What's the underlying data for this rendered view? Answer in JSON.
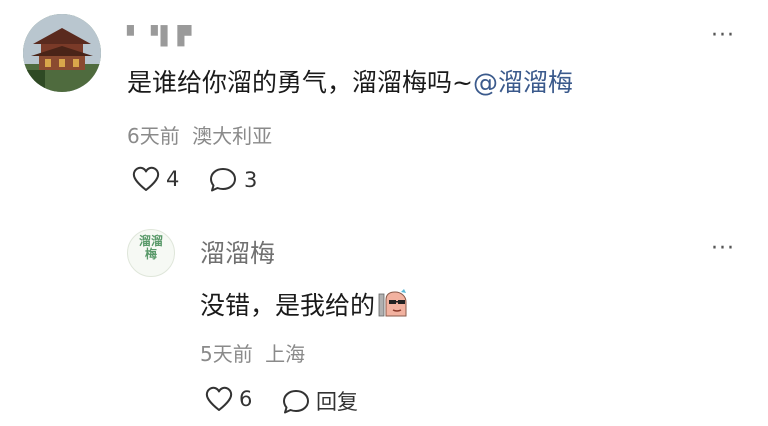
{
  "comment": {
    "username": "▘▝▌▛",
    "text": "是谁给你溜的勇气，溜溜梅吗~",
    "mention": "@溜溜梅",
    "time": "6天前",
    "location": "澳大利亚",
    "likes": "4",
    "replies": "3",
    "more_label": "···"
  },
  "reply": {
    "username": "溜溜梅",
    "avatar_text": "溜溜梅",
    "text": "没错，是我给的",
    "time": "5天前",
    "location": "上海",
    "likes": "6",
    "reply_label": "回复",
    "more_label": "···"
  },
  "icons": {
    "like": "heart-icon",
    "comment": "comment-bubble-icon",
    "more": "more-dots-icon",
    "emoji": "sticker-emoji-icon"
  },
  "colors": {
    "mention": "#3b5a8c",
    "meta": "#8a8a8a",
    "brand_green": "#5a9a6a"
  }
}
